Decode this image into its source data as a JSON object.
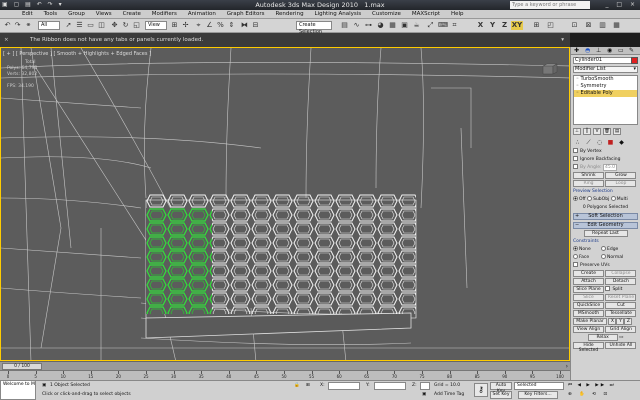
{
  "app": {
    "title": "Autodesk 3ds Max Design 2010",
    "file": "1.max",
    "search_placeholder": "Type a keyword or phrase",
    "window_buttons": "_ □ ×"
  },
  "menus": [
    "Edit",
    "Tools",
    "Group",
    "Views",
    "Create",
    "Modifiers",
    "Animation",
    "Graph Editors",
    "Rendering",
    "Lighting Analysis",
    "Customize",
    "MAXScript",
    "Help"
  ],
  "toolbar": {
    "selection_filter": "All",
    "reference_coord": "View",
    "named_selection_placeholder": "Create Selection Set",
    "axis_x": "X",
    "axis_y": "Y",
    "axis_z": "Z",
    "axis_xy": "XY"
  },
  "ribbon": {
    "message": "The Ribbon does not have any tabs or panels currently loaded."
  },
  "viewport": {
    "label": "[ + ] [ Perspective ] [ Smooth + Highlights + Edged Faces ]",
    "stats": {
      "total_label": "Total",
      "polys_label": "Polys:",
      "polys_value": "64,798",
      "verts_label": "Verts:",
      "verts_value": "32,802",
      "fps_label": "FPS:",
      "fps_value": "34.190"
    }
  },
  "command_panel": {
    "object_name": "Cylinder01",
    "modifier_list": "Modifier List",
    "stack": [
      "TurboSmooth",
      "Symmetry",
      "Editable Poly"
    ],
    "selected_stack_index": 2,
    "by_vertex": "By Vertex",
    "ignore_backfacing": "Ignore Backfacing",
    "by_angle": "By Angle:",
    "by_angle_value": "45.0",
    "shrink": "Shrink",
    "grow": "Grow",
    "ring": "Ring",
    "loop": "Loop",
    "preview_selection": "Preview Selection",
    "preview_off": "Off",
    "preview_subobj": "SubObj",
    "preview_multi": "Multi",
    "selected_info": "0 Polygons Selected",
    "soft_selection": "Soft Selection",
    "edit_geometry": "Edit Geometry",
    "repeat_last": "Repeat Last",
    "constraints": "Constraints",
    "c_none": "None",
    "c_edge": "Edge",
    "c_face": "Face",
    "c_normal": "Normal",
    "preserve_uvs": "Preserve UVs",
    "create": "Create",
    "collapse": "Collapse",
    "attach": "Attach",
    "detach": "Detach",
    "slice_plane": "Slice Plane",
    "split": "Split",
    "slice": "Slice",
    "reset_plane": "Reset Plane",
    "quickslice": "QuickSlice",
    "cut": "Cut",
    "msmooth": "MSmooth",
    "tessellate": "Tessellate",
    "make_planar": "Make Planar",
    "x": "X",
    "y": "Y",
    "z": "Z",
    "view_align": "View Align",
    "grid_align": "Grid Align",
    "relax": "Relax",
    "hide_selected": "Hide Selected",
    "unhide_all": "Unhide All"
  },
  "timeline": {
    "frame": "0 / 100",
    "ticks": [
      0,
      5,
      10,
      15,
      20,
      25,
      30,
      35,
      40,
      45,
      50,
      55,
      60,
      65,
      70,
      75,
      80,
      85,
      90,
      95,
      100
    ]
  },
  "status": {
    "welcome": "Welcome to M",
    "objects_selected": "1 Object Selected",
    "prompt": "Click or click-and-drag to select objects",
    "x_label": "X:",
    "y_label": "Y:",
    "z_label": "Z:",
    "grid": "Grid = 10.0",
    "add_time_tag": "Add Time Tag",
    "auto_key": "Auto Key",
    "set_key": "Set Key",
    "selected_dropdown": "Selected",
    "key_filters": "Key Filters..."
  }
}
